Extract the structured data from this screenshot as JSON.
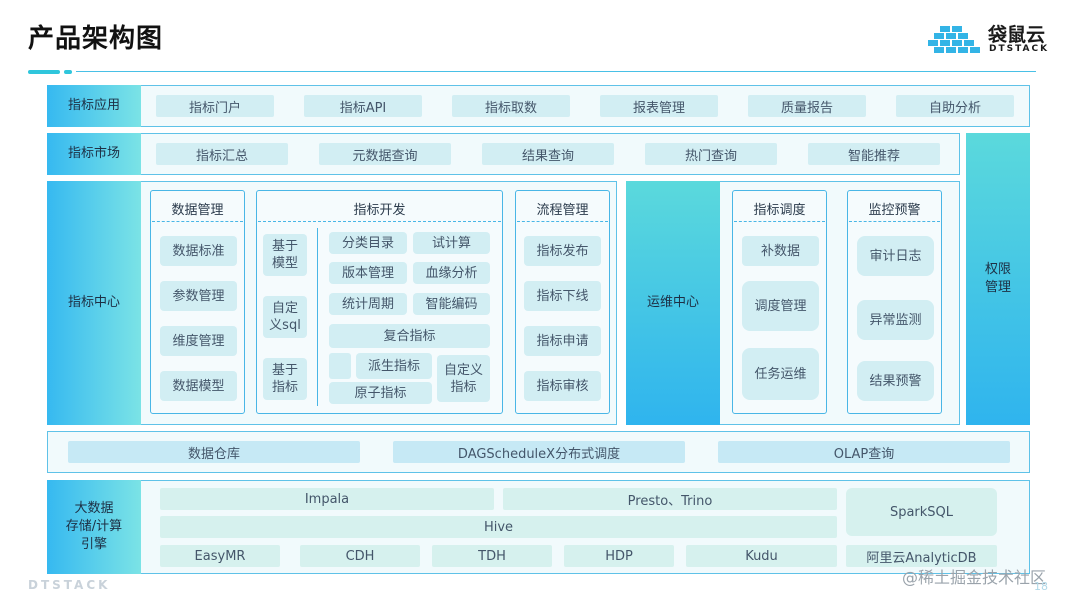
{
  "title": "产品架构图",
  "logo": {
    "cn": "袋鼠云",
    "en": "DTSTACK"
  },
  "footer": {
    "logo": "DTSTACK",
    "watermark": "@稀土掘金技术社区",
    "page": "18"
  },
  "rows": {
    "app": {
      "label": "指标应用",
      "items": [
        "指标门户",
        "指标API",
        "指标取数",
        "报表管理",
        "质量报告",
        "自助分析"
      ]
    },
    "market": {
      "label": "指标市场",
      "items": [
        "指标汇总",
        "元数据查询",
        "结果查询",
        "热门查询",
        "智能推荐"
      ]
    },
    "permission": {
      "label": "权限\n管理"
    },
    "center": {
      "label": "指标中心",
      "data_mgmt": {
        "title": "数据管理",
        "items": [
          "数据标准",
          "参数管理",
          "维度管理",
          "数据模型"
        ]
      },
      "dev": {
        "title": "指标开发",
        "left": [
          "基于\n模型",
          "自定\n义sql",
          "基于\n指标"
        ],
        "grid": [
          "分类目录",
          "试计算",
          "版本管理",
          "血缘分析",
          "统计周期",
          "智能编码"
        ],
        "composite": "复合指标",
        "derived": "派生指标",
        "atomic": "原子指标",
        "custom": "自定义\n指标"
      },
      "flow": {
        "title": "流程管理",
        "items": [
          "指标发布",
          "指标下线",
          "指标申请",
          "指标审核"
        ]
      }
    },
    "ops": {
      "label": "运维中心",
      "schedule": {
        "title": "指标调度",
        "items": [
          "补数据",
          "调度管理",
          "任务运维"
        ]
      },
      "monitor": {
        "title": "监控预警",
        "items": [
          "审计日志",
          "异常监测",
          "结果预警"
        ]
      }
    },
    "infra": {
      "items": [
        "数据仓库",
        "DAGScheduleX分布式调度",
        "OLAP查询"
      ]
    },
    "engine": {
      "label": "大数据\n存储/计算\n引擎",
      "impala": "Impala",
      "presto": "Presto、Trino",
      "spark": "SparkSQL",
      "hive": "Hive",
      "bottom": [
        "EasyMR",
        "CDH",
        "TDH",
        "HDP",
        "Kudu",
        "阿里云AnalyticDB"
      ]
    }
  },
  "colors": {
    "accent": "#2fc6dc",
    "border": "#5fc2e8",
    "pill": "#d2eef3"
  }
}
